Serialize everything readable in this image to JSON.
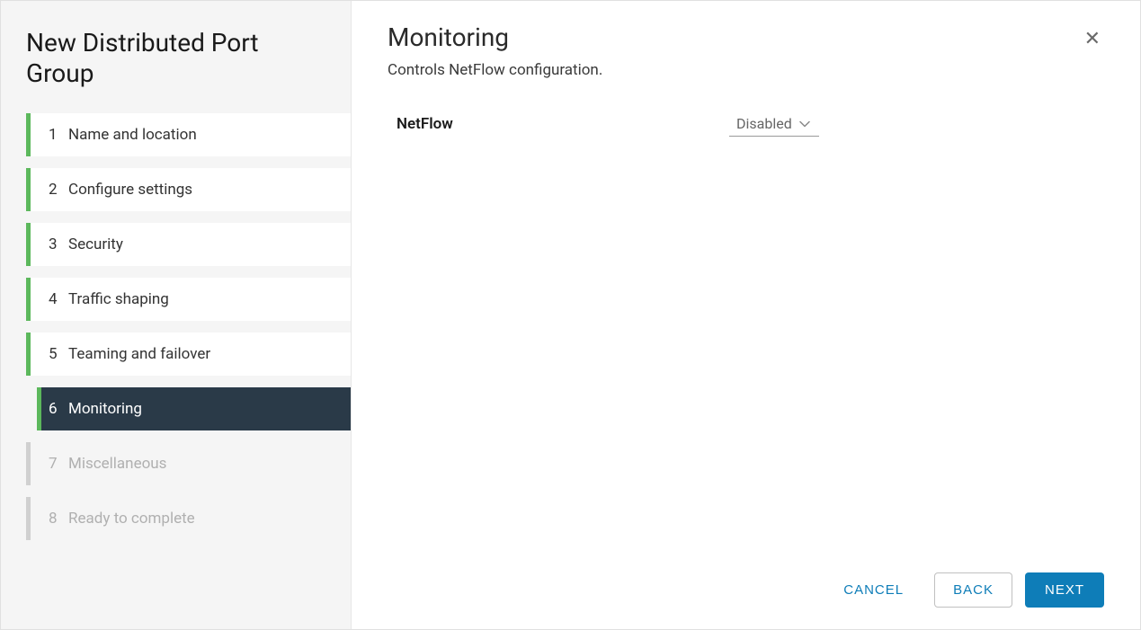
{
  "sidebar": {
    "title": "New Distributed Port Group",
    "steps": [
      {
        "number": "1",
        "label": "Name and location",
        "state": "done"
      },
      {
        "number": "2",
        "label": "Configure settings",
        "state": "done"
      },
      {
        "number": "3",
        "label": "Security",
        "state": "done"
      },
      {
        "number": "4",
        "label": "Traffic shaping",
        "state": "done"
      },
      {
        "number": "5",
        "label": "Teaming and failover",
        "state": "done"
      },
      {
        "number": "6",
        "label": "Monitoring",
        "state": "active"
      },
      {
        "number": "7",
        "label": "Miscellaneous",
        "state": "disabled"
      },
      {
        "number": "8",
        "label": "Ready to complete",
        "state": "disabled"
      }
    ]
  },
  "main": {
    "title": "Monitoring",
    "subtitle": "Controls NetFlow configuration.",
    "fields": {
      "netflow_label": "NetFlow",
      "netflow_value": "Disabled"
    }
  },
  "footer": {
    "cancel": "CANCEL",
    "back": "BACK",
    "next": "NEXT"
  }
}
